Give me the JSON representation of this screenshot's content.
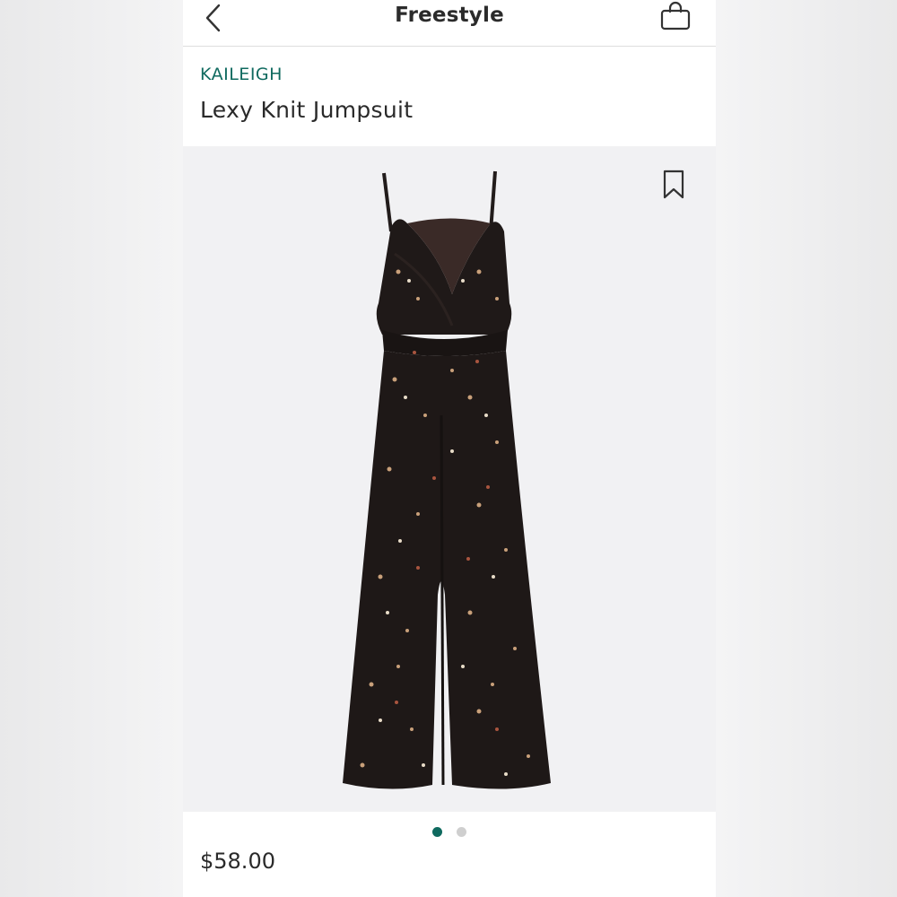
{
  "header": {
    "title": "Freestyle",
    "back_icon": "chevron-left-icon",
    "bag_icon": "shopping-bag-icon"
  },
  "product": {
    "brand": "KAILEIGH",
    "name": "Lexy Knit Jumpsuit",
    "price": "$58.00",
    "image_alt": "Black floral print knit jumpsuit with spaghetti straps, surplice neckline and wide legs",
    "bookmark_icon": "bookmark-icon"
  },
  "carousel": {
    "page_count": 2,
    "active_index": 0
  },
  "colors": {
    "accent": "#0f6a5f",
    "text": "#2a2a2a",
    "image_bg": "#f1f1f3",
    "garment": "#1e1817"
  }
}
